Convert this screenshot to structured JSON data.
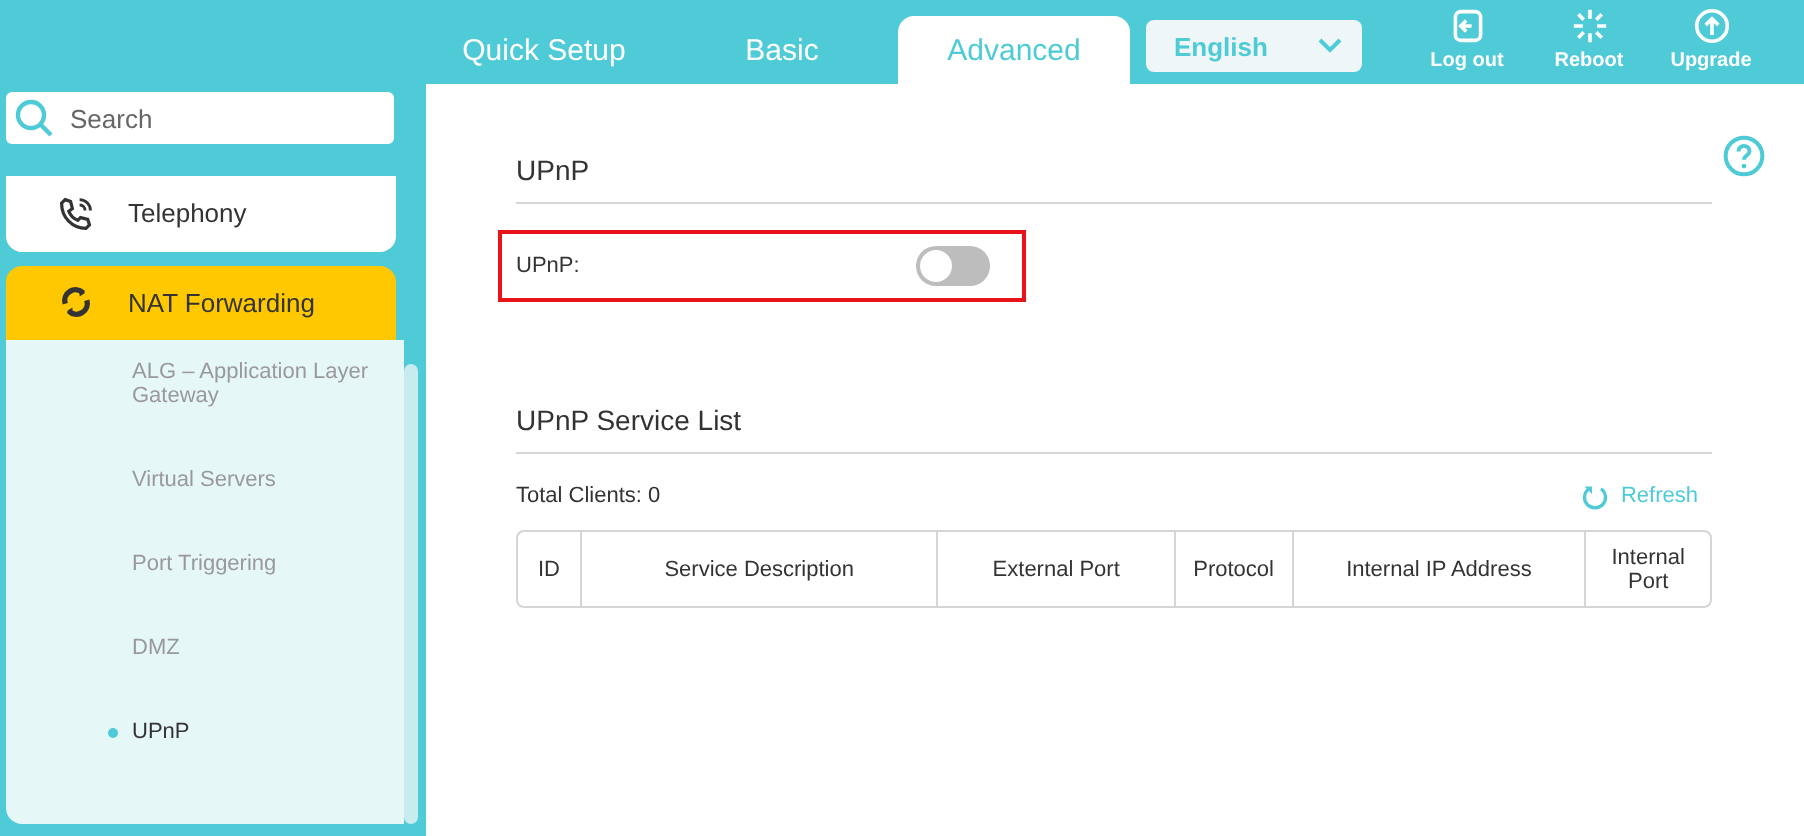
{
  "top_tabs": [
    {
      "label": "Quick Setup",
      "selected": false
    },
    {
      "label": "Basic",
      "selected": false
    },
    {
      "label": "Advanced",
      "selected": true
    }
  ],
  "language": {
    "value": "English"
  },
  "top_actions": [
    {
      "kind": "logout",
      "label": "Log out"
    },
    {
      "kind": "reboot",
      "label": "Reboot"
    },
    {
      "kind": "upgrade",
      "label": "Upgrade"
    }
  ],
  "sidebar": {
    "search": {
      "placeholder": "Search"
    },
    "items": [
      {
        "kind": "telephony",
        "label": "Telephony",
        "selected": false
      },
      {
        "kind": "nat",
        "label": "NAT Forwarding",
        "selected": true,
        "children": [
          {
            "label": "ALG – Application Layer Gateway",
            "selected": false
          },
          {
            "label": "Virtual Servers",
            "selected": false
          },
          {
            "label": "Port Triggering",
            "selected": false
          },
          {
            "label": "DMZ",
            "selected": false
          },
          {
            "label": "UPnP",
            "selected": true
          }
        ]
      }
    ]
  },
  "upnp_section": {
    "title": "UPnP",
    "toggle": {
      "label": "UPnP:",
      "on": false
    }
  },
  "service_list": {
    "title": "UPnP Service List",
    "total": "Total Clients: 0",
    "refresh": "Refresh",
    "columns": [
      "ID",
      "Service Description",
      "External Port",
      "Protocol",
      "Internal IP Address",
      "Internal Port"
    ]
  }
}
